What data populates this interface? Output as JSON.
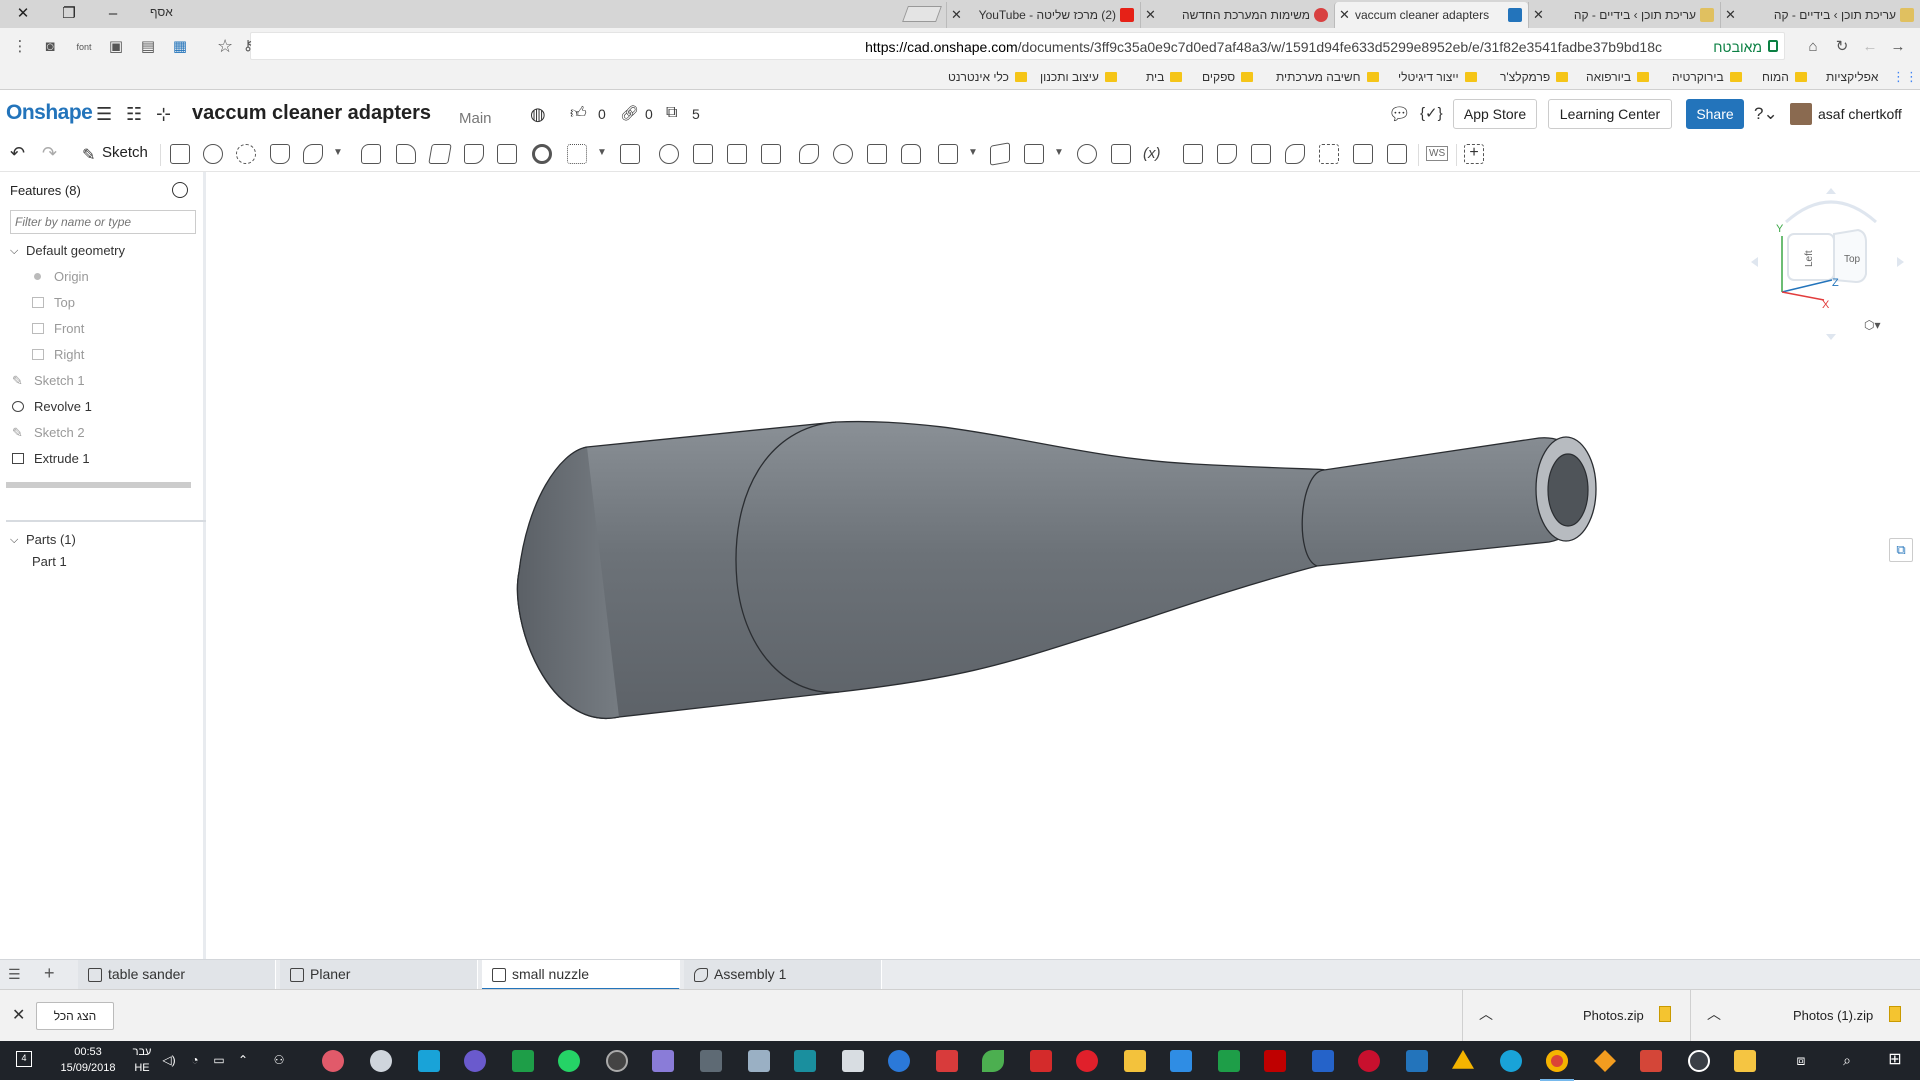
{
  "browser": {
    "profile_name": "אסף",
    "tabs": [
      {
        "title": "עריכת תוכן › בידיים - קה",
        "color": "#e0c060",
        "active": false
      },
      {
        "title": "עריכת תוכן › בידיים - קה",
        "color": "#e0c060",
        "active": false
      },
      {
        "title": "vaccum cleaner adapters",
        "color": "#2374bb",
        "active": true
      },
      {
        "title": "משימות המערכת החדשה",
        "color": "#d84040",
        "active": false
      },
      {
        "title": "(2) מרכז שליטה - YouTube",
        "color": "#e62117",
        "active": false
      }
    ],
    "url_host": "https://cad.onshape.com",
    "url_path": "/documents/3ff9c35a0e9c7d0ed7af48a3/w/1591d94fe633d5299e8952eb/e/31f82e3541fadbe37b9bd18c",
    "secure_label": "מאובטח",
    "bookmarks": [
      "אפליקציות",
      "המוח",
      "בירוקרטיה",
      "ביורפואה",
      "פרמקלצ'ר",
      "ייצור דיגיטלי",
      "חשיבה מערכתית",
      "ספקים",
      "בית",
      "עיצוב ותכנון",
      "כלי אינטרנט"
    ]
  },
  "app": {
    "logo": "Onshape",
    "document_title": "vaccum cleaner adapters",
    "branch": "Main",
    "likes": "0",
    "links": "0",
    "versions": "5",
    "app_store_label": "App Store",
    "learning_center_label": "Learning Center",
    "share_label": "Share",
    "user_name": "asaf chertkoff",
    "sketch_label": "Sketch"
  },
  "features": {
    "title": "Features (8)",
    "filter_placeholder": "Filter by name or type",
    "default_geometry_label": "Default geometry",
    "default_items": [
      "Origin",
      "Top",
      "Front",
      "Right"
    ],
    "items": [
      {
        "label": "Sketch 1",
        "icon": "sketch-icon",
        "dim": true
      },
      {
        "label": "Revolve 1",
        "icon": "revolve-icon",
        "dim": false
      },
      {
        "label": "Sketch 2",
        "icon": "sketch-icon",
        "dim": true
      },
      {
        "label": "Extrude 1",
        "icon": "extrude-icon",
        "dim": false
      }
    ],
    "parts_title": "Parts (1)",
    "parts": [
      "Part 1"
    ]
  },
  "viewcube": {
    "front_face": "Left",
    "side_face": "Top",
    "axis_y": "Y",
    "axis_z": "Z",
    "axis_x": "X"
  },
  "doc_tabs": [
    {
      "label": "table sander",
      "active": false
    },
    {
      "label": "Planer",
      "active": false
    },
    {
      "label": "small nuzzle",
      "active": true
    },
    {
      "label": "Assembly 1",
      "active": false
    }
  ],
  "downloads": {
    "show_all_label": "הצג הכל",
    "items": [
      "Photos (1).zip",
      "Photos.zip"
    ]
  },
  "taskbar": {
    "time": "00:53",
    "date": "15/09/2018",
    "lang_top": "עבר",
    "lang_bottom": "HE",
    "notification_count": "4"
  },
  "colors": {
    "brand": "#2374bb",
    "model_body": "#6f757c"
  }
}
